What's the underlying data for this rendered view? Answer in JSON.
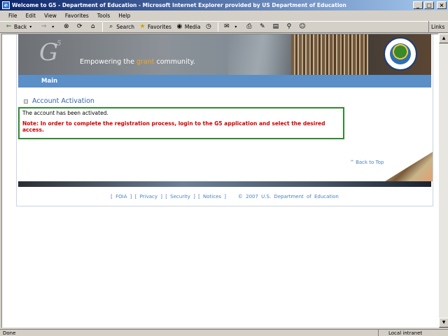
{
  "window": {
    "title": "Welcome to G5 - Department of Education - Microsoft Internet Explorer provided by US Department of Education",
    "min": "_",
    "max": "□",
    "close": "×"
  },
  "menu": [
    "File",
    "Edit",
    "View",
    "Favorites",
    "Tools",
    "Help"
  ],
  "toolbar": {
    "back": "Back",
    "search": "Search",
    "favorites": "Favorites",
    "media": "Media",
    "links": "Links"
  },
  "banner": {
    "logo": "G",
    "logo_sup": "5",
    "tagline_pre": "Empowering the ",
    "tagline_em": "grant",
    "tagline_post": " community."
  },
  "nav": {
    "main": "Main"
  },
  "content": {
    "section_title": "Account Activation",
    "message": "The account has been activated.",
    "note": "Note: In order to complete the registration process, login to the G5 application and select the desired access."
  },
  "back_to_top": "^ Back to Top",
  "footer": {
    "foia": "FOIA",
    "privacy": "Privacy",
    "security": "Security",
    "notices": "Notices",
    "copyright": "© 2007 U.S. Department of Education"
  },
  "status": {
    "text": "Done",
    "zone": "Local intranet"
  }
}
